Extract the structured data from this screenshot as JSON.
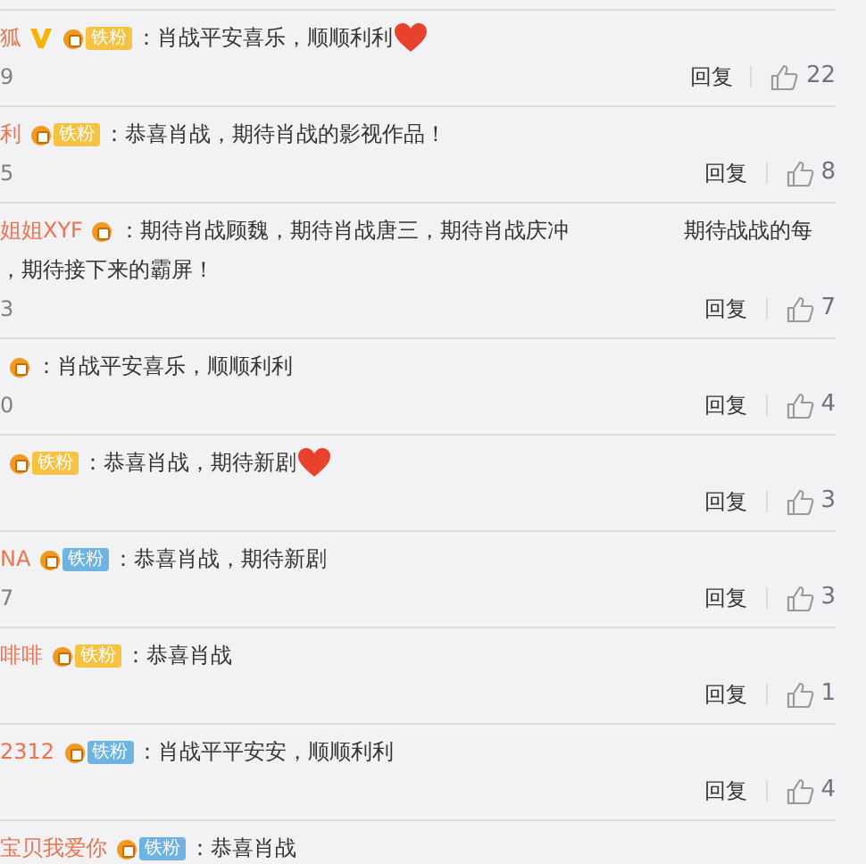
{
  "comments": [
    {
      "name": "狐",
      "verified": true,
      "badge": {
        "kind": "gold",
        "label": "铁粉"
      },
      "text": "：肖战平安喜乐，顺顺利利",
      "heart": true,
      "date": "9",
      "reply": "回复",
      "likes": "22"
    },
    {
      "name": "利",
      "badge": {
        "kind": "gold",
        "label": "铁粉"
      },
      "text": "：恭喜肖战，期待肖战的影视作品！",
      "date": "5",
      "reply": "回复",
      "likes": "8"
    },
    {
      "name": "姐姐XYF",
      "badge": {
        "kind": "gold"
      },
      "text": "：期待肖战顾魏，期待肖战唐三，期待肖战庆冲",
      "text_right": "期待战战的每",
      "text_2": "，期待接下来的霸屏！",
      "date": "3",
      "reply": "回复",
      "likes": "7"
    },
    {
      "badge": {
        "kind": "gold"
      },
      "text": "：肖战平安喜乐，顺顺利利",
      "date": "0",
      "reply": "回复",
      "likes": "4"
    },
    {
      "badge": {
        "kind": "gold",
        "label": "铁粉"
      },
      "text": "：恭喜肖战，期待新剧",
      "heart": true,
      "reply": "回复",
      "likes": "3"
    },
    {
      "name": "NA",
      "badge": {
        "kind": "blue",
        "label": "铁粉"
      },
      "text": "：恭喜肖战，期待新剧",
      "date": "7",
      "reply": "回复",
      "likes": "3"
    },
    {
      "name": "啡啡",
      "badge": {
        "kind": "gold",
        "label": "铁粉"
      },
      "text": "：恭喜肖战",
      "reply": "回复",
      "likes": "1"
    },
    {
      "name": "2312",
      "badge": {
        "kind": "blue",
        "label": "铁粉"
      },
      "text": "：肖战平平安安，顺顺利利",
      "reply": "回复",
      "likes": "4"
    },
    {
      "name": "宝贝我爱你",
      "badge": {
        "kind": "blue",
        "label": "铁粉"
      },
      "text": "：恭喜肖战"
    }
  ]
}
